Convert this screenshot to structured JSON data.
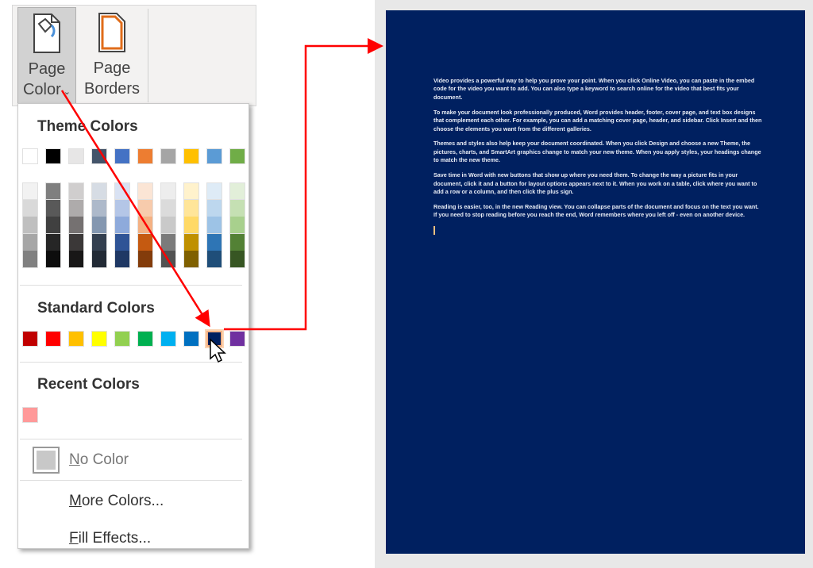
{
  "ribbon": {
    "page_color_label1": "Page",
    "page_color_label2": "Color",
    "page_borders_label1": "Page",
    "page_borders_label2": "Borders"
  },
  "menu": {
    "theme_header": "Theme Colors",
    "theme_base": [
      "#ffffff",
      "#000000",
      "#e7e6e6",
      "#44546a",
      "#4472c4",
      "#ed7d31",
      "#a5a5a5",
      "#ffc000",
      "#5b9bd5",
      "#70ad47"
    ],
    "theme_shades": [
      [
        "#f2f2f2",
        "#d9d9d9",
        "#bfbfbf",
        "#a6a6a6",
        "#808080"
      ],
      [
        "#7f7f7f",
        "#595959",
        "#404040",
        "#262626",
        "#0d0d0d"
      ],
      [
        "#d0cece",
        "#aeabab",
        "#757171",
        "#3b3838",
        "#181717"
      ],
      [
        "#d6dce4",
        "#adb9ca",
        "#8497b0",
        "#333f4f",
        "#222a35"
      ],
      [
        "#d9e2f3",
        "#b4c6e7",
        "#8eaadb",
        "#2f5496",
        "#1f3864"
      ],
      [
        "#fbe5d5",
        "#f7cbac",
        "#f4b183",
        "#c55a11",
        "#833c0b"
      ],
      [
        "#ededed",
        "#dbdbdb",
        "#c9c9c9",
        "#7b7b7b",
        "#525252"
      ],
      [
        "#fff2cc",
        "#ffe599",
        "#ffd966",
        "#bf9000",
        "#7f6000"
      ],
      [
        "#deebf6",
        "#bdd7ee",
        "#9dc3e6",
        "#2e75b5",
        "#1f4e79"
      ],
      [
        "#e2efd9",
        "#c5e0b3",
        "#a8d08d",
        "#538135",
        "#375623"
      ]
    ],
    "standard_header": "Standard Colors",
    "standard": [
      "#c00000",
      "#ff0000",
      "#ffc000",
      "#ffff00",
      "#92d050",
      "#00b050",
      "#00b0f0",
      "#0070c0",
      "#002060",
      "#7030a0"
    ],
    "selected_standard": "#002060",
    "recent_header": "Recent Colors",
    "recent": [
      "#ff9999"
    ],
    "no_color_key": "N",
    "no_color_rest": "o Color",
    "more_colors_key": "M",
    "more_colors_rest": "ore Colors...",
    "fill_effects_key": "F",
    "fill_effects_rest": "ill Effects..."
  },
  "document": {
    "page_color": "#002060",
    "paragraphs": [
      "Video provides a powerful way to help you prove your point. When you click Online Video, you can paste in the embed code for the video you want to add. You can also type a keyword to search online for the video that best fits your document.",
      "To make your document look professionally produced, Word provides header, footer, cover page, and text box designs that complement each other. For example, you can add a matching cover page, header, and sidebar. Click Insert and then choose the elements you want from the different galleries.",
      "Themes and styles also help keep your document coordinated. When you click Design and choose a new Theme, the pictures, charts, and SmartArt graphics change to match your new theme. When you apply styles, your headings change to match the new theme.",
      "Save time in Word with new buttons that show up where you need them. To change the way a picture fits in your document, click it and a button for layout options appears next to it. When you work on a table, click where you want to add a row or a column, and then click the plus sign.",
      "Reading is easier, too, in the new Reading view. You can collapse parts of the document and focus on the text you want. If you need to stop reading before you reach the end, Word remembers where you left off - even on another device."
    ]
  },
  "annotation_color": "#ff0000"
}
